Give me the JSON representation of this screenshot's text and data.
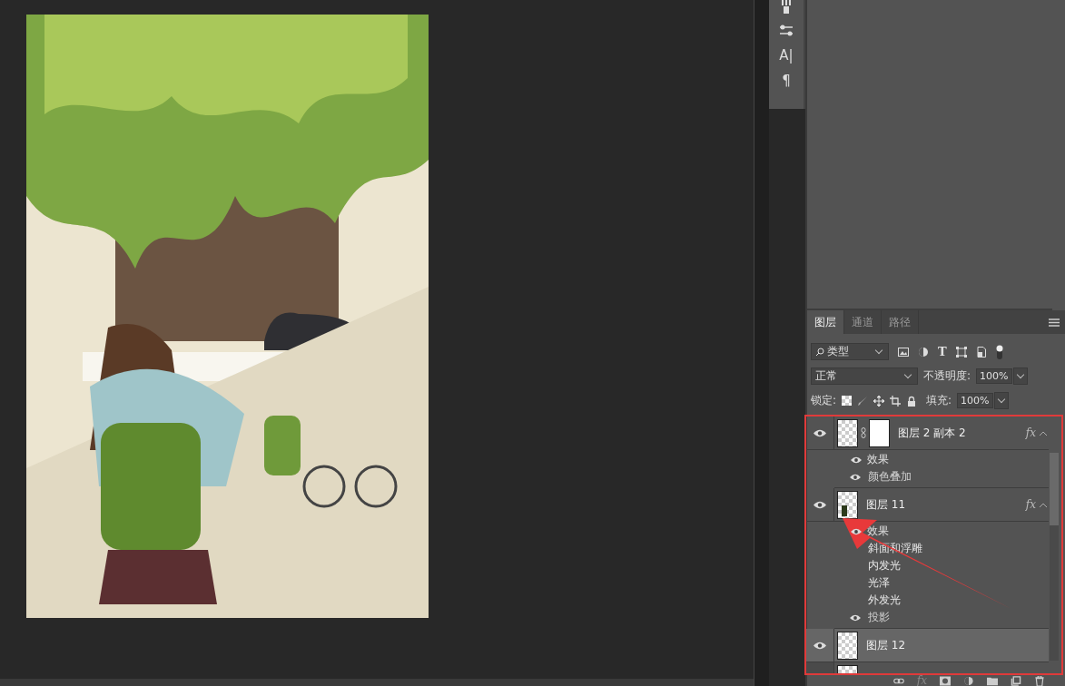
{
  "tool_strip": [
    {
      "kind": "brushes"
    },
    {
      "kind": "adjust"
    },
    {
      "kind": "glyph",
      "glyph": "A|"
    },
    {
      "kind": "glyph",
      "glyph": "¶"
    }
  ],
  "panel_tabs": [
    {
      "label": "图层",
      "selected": true
    },
    {
      "label": "通道",
      "selected": false
    },
    {
      "label": "路径",
      "selected": false
    }
  ],
  "filter": {
    "value": "类型",
    "type_glyph": "T"
  },
  "blend_mode": {
    "value": "正常"
  },
  "opacity": {
    "label": "不透明度:",
    "value": "100%"
  },
  "lock": {
    "label": "锁定:"
  },
  "fill": {
    "label": "填充:",
    "value": "100%"
  },
  "layers": [
    {
      "name": "图层 2 副本 2",
      "visible": true,
      "selected": false,
      "mask": true,
      "fx": "fx",
      "effects_label": "效果",
      "effects": [
        {
          "name": "颜色叠加",
          "visible": true
        }
      ]
    },
    {
      "name": "图层 11",
      "visible": true,
      "selected": false,
      "mask": false,
      "fx": "fx",
      "effects_label": "效果",
      "effects": [
        {
          "name": "斜面和浮雕",
          "visible": false
        },
        {
          "name": "内发光",
          "visible": false
        },
        {
          "name": "光泽",
          "visible": false
        },
        {
          "name": "外发光",
          "visible": false
        },
        {
          "name": "投影",
          "visible": true
        }
      ]
    },
    {
      "name": "图层 12",
      "visible": true,
      "selected": true,
      "mask": false
    },
    {
      "visible": false,
      "selected": false,
      "mask": false
    }
  ],
  "bottom_fx": "fx"
}
